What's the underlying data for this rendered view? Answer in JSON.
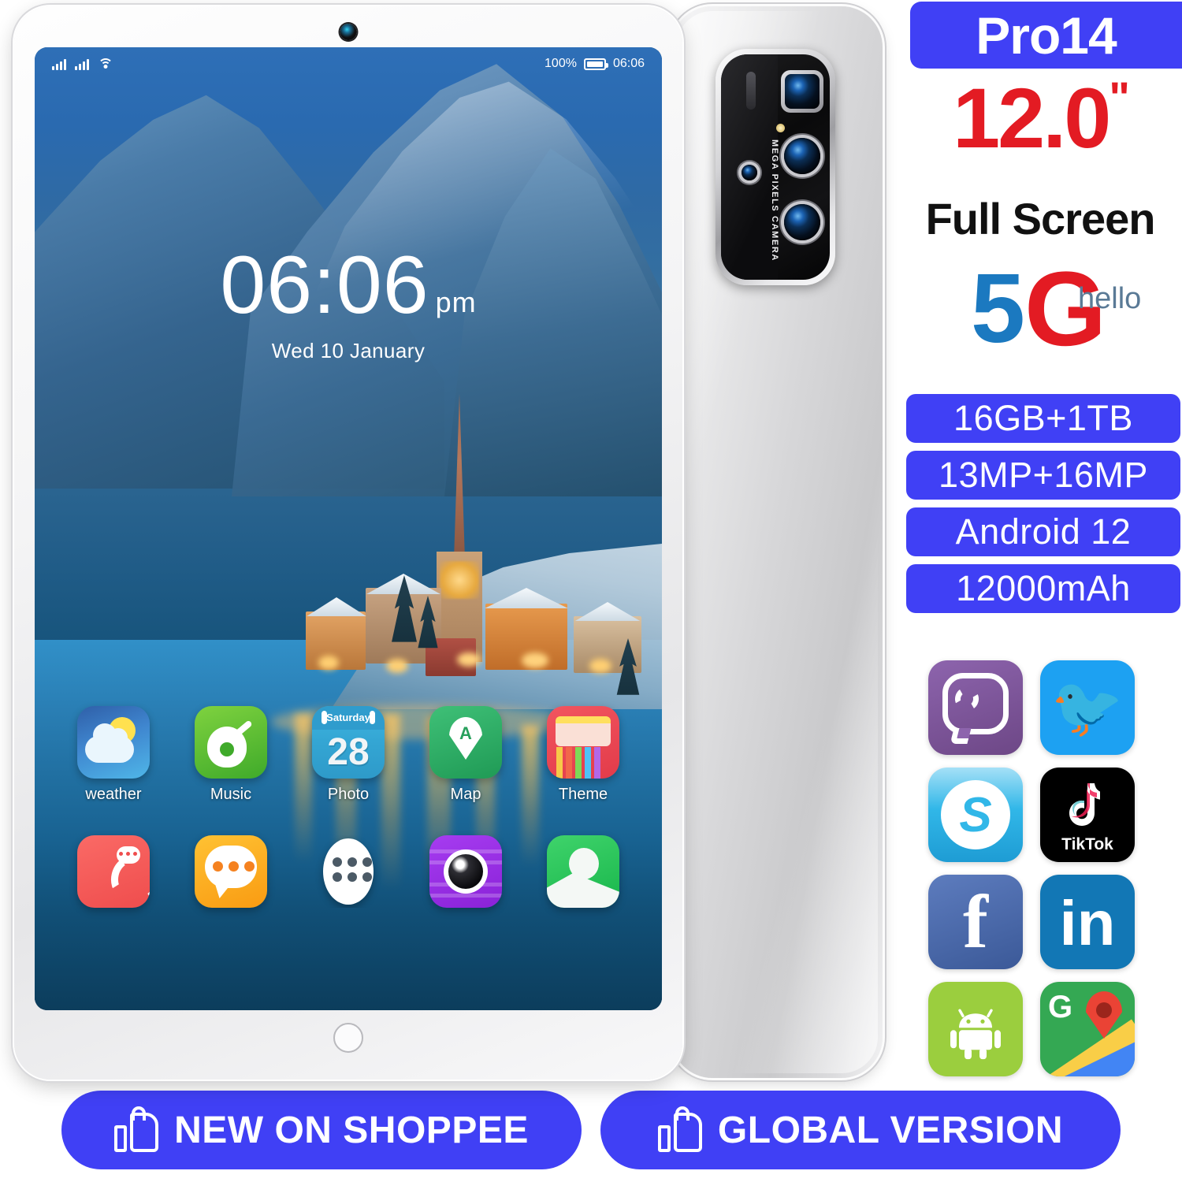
{
  "product": {
    "model_badge": "Pro14",
    "screen_size": "12.0",
    "screen_size_unit": "\"",
    "screen_type": "Full Screen",
    "network_5g": "5",
    "network_g": "G",
    "network_hello": "hello",
    "camera_module_text": "MEGA PIXELS CAMERA"
  },
  "specs": [
    {
      "label": "16GB+1TB"
    },
    {
      "label": "13MP+16MP"
    },
    {
      "label": "Android 12"
    },
    {
      "label": "12000mAh"
    }
  ],
  "social_apps": [
    {
      "name": "Viber",
      "icon": "viber-icon"
    },
    {
      "name": "Twitter",
      "icon": "twitter-icon"
    },
    {
      "name": "Skype",
      "icon": "skype-icon",
      "glyph": "S"
    },
    {
      "name": "TikTok",
      "icon": "tiktok-icon",
      "label": "TikTok"
    },
    {
      "name": "Facebook",
      "icon": "facebook-icon",
      "glyph": "f"
    },
    {
      "name": "LinkedIn",
      "icon": "linkedin-icon",
      "glyph": "in"
    },
    {
      "name": "Android",
      "icon": "android-icon"
    },
    {
      "name": "Google Maps",
      "icon": "google-maps-icon",
      "glyph": "G"
    }
  ],
  "tablet": {
    "statusbar": {
      "battery_percent": "100%",
      "time": "06:06",
      "signal_icon": "signal-bars-icon",
      "wifi_icon": "wifi-icon",
      "battery_icon": "battery-icon"
    },
    "lockscreen": {
      "time": "06:06",
      "ampm": "pm",
      "date": "Wed 10 January"
    },
    "apps_row1": [
      {
        "label": "weather",
        "icon": "weather-icon"
      },
      {
        "label": "Music",
        "icon": "music-icon"
      },
      {
        "label": "Photo",
        "icon": "calendar-icon",
        "day_name": "Saturday",
        "day_num": "28"
      },
      {
        "label": "Map",
        "icon": "map-icon",
        "glyph": "A"
      },
      {
        "label": "Theme",
        "icon": "theme-icon"
      }
    ],
    "apps_row2": [
      {
        "label": "",
        "icon": "phone-icon"
      },
      {
        "label": "",
        "icon": "messages-icon"
      },
      {
        "label": "",
        "icon": "app-drawer-icon"
      },
      {
        "label": "",
        "icon": "camera-icon"
      },
      {
        "label": "",
        "icon": "gallery-icon"
      }
    ]
  },
  "banners": [
    {
      "label": "NEW ON SHOPPEE",
      "icon": "thumbs-up-icon"
    },
    {
      "label": "GLOBAL VERSION",
      "icon": "thumbs-up-icon"
    }
  ],
  "colors": {
    "brand_blue": "#4040f5",
    "accent_red": "#e31b23",
    "g5_blue": "#1b79c0",
    "hello_grey": "#5a7a96"
  }
}
